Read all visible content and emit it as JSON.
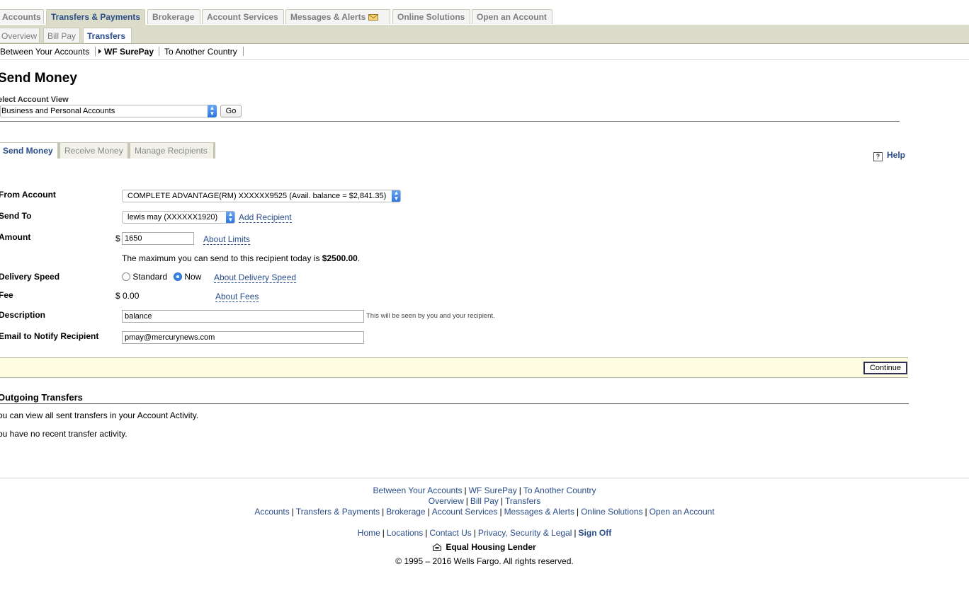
{
  "main_tabs": [
    {
      "label": "Accounts",
      "active": false
    },
    {
      "label": "Transfers & Payments",
      "active": true
    },
    {
      "label": "Brokerage",
      "active": false
    },
    {
      "label": "Account Services",
      "active": false
    },
    {
      "label": "Messages & Alerts",
      "active": false,
      "icon": "envelope-icon"
    },
    {
      "label": "Online Solutions",
      "active": false
    },
    {
      "label": "Open an Account",
      "active": false
    }
  ],
  "sub_tabs": [
    {
      "label": "Overview",
      "active": false
    },
    {
      "label": "Bill Pay",
      "active": false
    },
    {
      "label": "Transfers",
      "active": true
    }
  ],
  "third_nav": [
    {
      "label": "Between Your Accounts",
      "active": false
    },
    {
      "label": "WF SurePay",
      "active": true
    },
    {
      "label": "To Another Country",
      "active": false
    }
  ],
  "page": {
    "title": "Send Money",
    "account_view_label": "elect Account View",
    "account_view_value": "Business and Personal Accounts",
    "go_label": "Go"
  },
  "tabs": [
    {
      "label": "Send Money",
      "active": true
    },
    {
      "label": "Receive Money",
      "active": false
    },
    {
      "label": "Manage Recipients",
      "active": false
    }
  ],
  "help_label": "Help",
  "form": {
    "from_account_label": "From Account",
    "from_account_value": "COMPLETE ADVANTAGE(RM) XXXXXX9525 (Avail. balance = $2,841.35)",
    "send_to_label": "Send To",
    "send_to_value": "lewis may (XXXXXX1920)",
    "add_recipient": "Add Recipient",
    "amount_label": "Amount",
    "currency_symbol": "$",
    "amount_value": "1650",
    "about_limits": "About Limits",
    "max_note_prefix": "The maximum you can send to this recipient today is ",
    "max_amount": "$2500.00",
    "max_note_suffix": ".",
    "delivery_label": "Delivery Speed",
    "delivery_options": [
      "Standard",
      "Now"
    ],
    "delivery_selected": "Now",
    "about_delivery": "About Delivery Speed",
    "fee_label": "Fee",
    "fee_value": "$ 0.00",
    "about_fees": "About Fees",
    "description_label": "Description",
    "description_value": "balance",
    "description_note": "This will be seen by you and your recipient.",
    "email_label": "Email to Notify Recipient",
    "email_value": "pmay@mercurynews.com",
    "continue_label": "Continue"
  },
  "outgoing": {
    "title": "Outgoing Transfers",
    "line1": "ou can view all sent transfers in your Account Activity.",
    "line2": "ou have no recent transfer activity."
  },
  "footer": {
    "row1": [
      "Between Your Accounts",
      "WF SurePay",
      "To Another Country"
    ],
    "row2": [
      "Overview",
      "Bill Pay",
      "Transfers"
    ],
    "row3": [
      "Accounts",
      "Transfers & Payments",
      "Brokerage",
      "Account Services",
      "Messages & Alerts",
      "Online Solutions",
      "Open an Account"
    ],
    "row4": [
      "Home",
      "Locations",
      "Contact Us",
      "Privacy, Security & Legal",
      "Sign Off"
    ],
    "equal_housing": "Equal Housing Lender",
    "copyright": "© 1995 – 2016 Wells Fargo. All rights reserved."
  },
  "colors": {
    "link": "#2a4d8a",
    "nav_bar": "#dcdccb",
    "continue_bar": "#fefde1",
    "select_arrow": "#2a74e0"
  }
}
